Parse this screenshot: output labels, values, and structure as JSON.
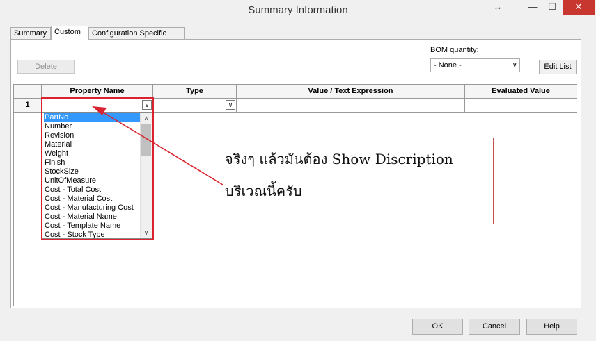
{
  "window": {
    "title": "Summary Information",
    "resize_glyph": "↔",
    "minimize_glyph": "—",
    "maximize_glyph": "☐",
    "close_glyph": "✕"
  },
  "tabs": [
    {
      "label": "Summary"
    },
    {
      "label": "Custom"
    },
    {
      "label": "Configuration Specific"
    }
  ],
  "toolbar": {
    "delete_label": "Delete",
    "bom_label": "BOM quantity:",
    "bom_value": "- None -",
    "edit_list_label": "Edit List"
  },
  "grid": {
    "headers": [
      "",
      "Property Name",
      "Type",
      "Value / Text Expression",
      "Evaluated Value"
    ],
    "rows": [
      {
        "num": "1",
        "property": "",
        "type": "",
        "value": "",
        "evaluated": ""
      }
    ]
  },
  "dropdown": {
    "items": [
      "PartNo",
      "Number",
      "Revision",
      "Material",
      "Weight",
      "Finish",
      "StockSize",
      "UnitOfMeasure",
      "Cost - Total Cost",
      "Cost - Material Cost",
      "Cost - Manufacturing Cost",
      "Cost - Material Name",
      "Cost - Template Name",
      "Cost - Stock Type"
    ],
    "selected_index": 0
  },
  "annotation": {
    "line1": "จริงๆ แล้วมันต้อง Show Discription",
    "line2": "บริเวณนี้ครับ",
    "color": "#d9232e"
  },
  "footer": {
    "ok_label": "OK",
    "cancel_label": "Cancel",
    "help_label": "Help"
  },
  "colors": {
    "selection": "#3399ff",
    "close_button": "#c7372f"
  }
}
